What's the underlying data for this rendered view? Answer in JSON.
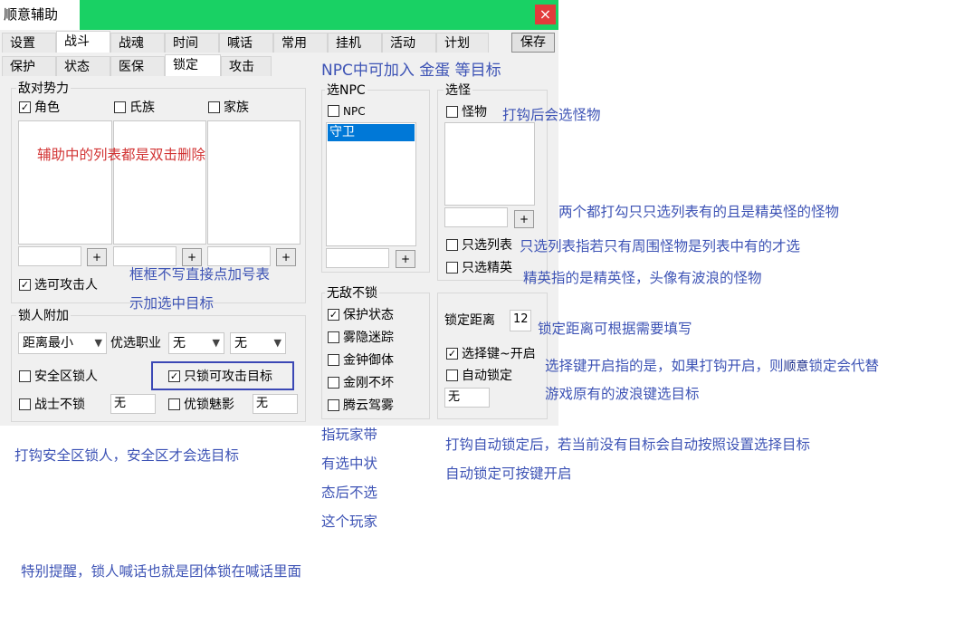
{
  "window": {
    "title": "顺意辅助",
    "close_glyph": "×",
    "save_label": "保存",
    "tabs_row1": [
      "设置",
      "战斗",
      "战魂",
      "时间",
      "喊话",
      "常用",
      "挂机",
      "活动",
      "计划"
    ],
    "tabs_row2": [
      "保护",
      "状态",
      "医保",
      "锁定",
      "攻击"
    ]
  },
  "enemy": {
    "title": "敌对势力",
    "role": "角色",
    "clan": "氏族",
    "family": "家族",
    "plus": "+",
    "attackable": "选可攻击人"
  },
  "npc": {
    "title": "选NPC",
    "npc_label": "NPC",
    "items": [
      "守卫"
    ],
    "plus": "+"
  },
  "monster": {
    "title": "选怪",
    "monster_label": "怪物",
    "plus": "+",
    "only_list": "只选列表",
    "only_elite": "只选精英"
  },
  "lock": {
    "title": "锁人附加",
    "distance_select": "距离最小",
    "prefer_job": "优选职业",
    "job1": "无",
    "job2": "无",
    "safe_zone": "安全区锁人",
    "only_attackable": "只锁可攻击目标",
    "warrior": "战士不锁",
    "warrior_value": "无",
    "prefer_charm": "优锁魅影",
    "charm_value": "无"
  },
  "invincible": {
    "title": "无敌不锁",
    "items": [
      "保护状态",
      "雾隐迷踪",
      "金钟御体",
      "金刚不坏",
      "腾云驾雾"
    ]
  },
  "lockset": {
    "distance_label": "锁定距离",
    "distance_value": "12",
    "select_key": "选择键~开启",
    "auto_lock": "自动锁定",
    "auto_value": "无"
  },
  "notes": {
    "npc_add": "NPC中可加入 金蛋 等目标",
    "list_delete": "辅助中的列表都是双击删除",
    "monster_tick": "打钩后会选怪物",
    "both_tick": "两个都打勾只只选列表有的且是精英怪的怪物",
    "only_list": "只选列表指若只有周围怪物是列表中有的才选",
    "elite": "精英指的是精英怪，头像有波浪的怪物",
    "box_empty1": "框框不写直接点加号表",
    "box_empty2": "示加选中目标",
    "distance": "锁定距离可根据需要填写",
    "select_key1a": "选择键开启指的是，如果打钩开启，则",
    "select_key1b": "顺意",
    "select_key1c": "锁定会代替",
    "select_key2": "游戏原有的波浪键选目标",
    "safe_zone": "打钩安全区锁人，安全区才会选目标",
    "player_status": [
      "指玩家带",
      "有选中状",
      "态后不选",
      "这个玩家"
    ],
    "auto_lock1": "打钩自动锁定后，若当前没有目标会自动按照设置选择目标",
    "auto_lock2": "自动锁定可按键开启",
    "reminder": "特别提醒，锁人喊话也就是团体锁在喊话里面"
  },
  "colors": {
    "titlebar": "#19d164",
    "note": "#3d53b5",
    "note_red": "#d23434",
    "selected": "#0078d7"
  }
}
